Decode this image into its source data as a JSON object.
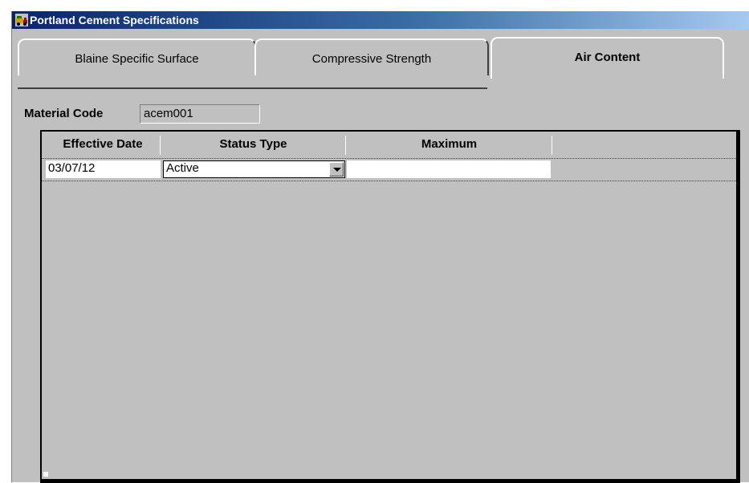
{
  "window": {
    "title": "Portland Cement Specifications",
    "icon": "truck-icon"
  },
  "tabs": [
    {
      "label": "Blaine Specific Surface",
      "active": false
    },
    {
      "label": "Compressive Strength",
      "active": false
    },
    {
      "label": "Air Content",
      "active": true
    }
  ],
  "material": {
    "label": "Material Code",
    "value": "acem001"
  },
  "grid": {
    "columns": [
      "Effective Date",
      "Status Type",
      "Maximum",
      ""
    ],
    "rows": [
      {
        "effective_date": "03/07/12",
        "status_type": "Active",
        "maximum": ""
      }
    ]
  }
}
